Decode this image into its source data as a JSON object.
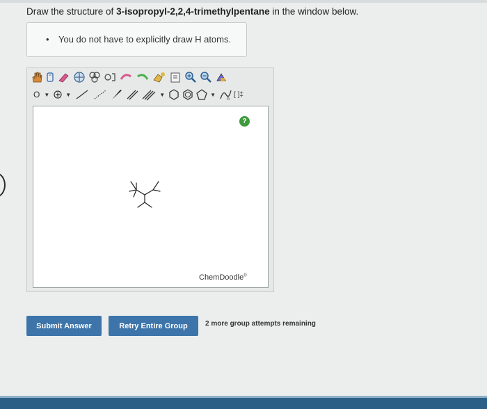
{
  "question": {
    "prefix": "Draw the structure of",
    "compound": "3-isopropyl-2,2,4-trimethylpentane",
    "suffix": "in the window below."
  },
  "hint": {
    "bullet": "•",
    "text": "You do not have to explicitly draw H atoms."
  },
  "sketcher": {
    "help_label": "?",
    "brand": "ChemDoodle",
    "brand_mark": "®",
    "atom_label": "O",
    "bracket_label": "[ ]‡"
  },
  "buttons": {
    "submit": "Submit Answer",
    "retry": "Retry Entire Group"
  },
  "attempts_text": "2 more group attempts remaining",
  "colors": {
    "button": "#3d74a9",
    "help": "#3e9a3c",
    "bottom_band": "#2b5f86"
  }
}
